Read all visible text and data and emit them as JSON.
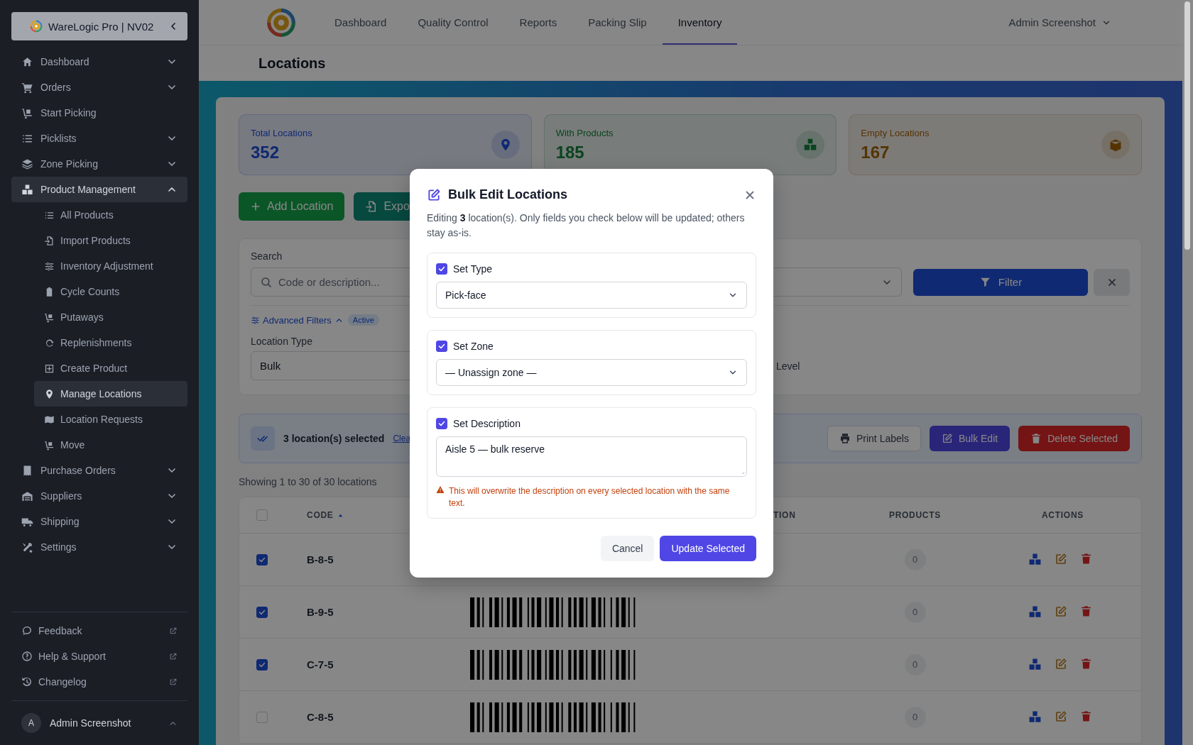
{
  "sidebar": {
    "brand": "WareLogic Pro | NV02",
    "items": [
      {
        "label": "Dashboard",
        "selected": false,
        "expanded": false
      },
      {
        "label": "Orders",
        "selected": false,
        "expanded": false
      },
      {
        "label": "Start Picking",
        "selected": false
      },
      {
        "label": "Picklists",
        "selected": false,
        "expanded": false
      },
      {
        "label": "Zone Picking",
        "selected": false,
        "expanded": false
      },
      {
        "label": "Product Management",
        "selected": false,
        "expanded": true,
        "children": [
          {
            "label": "All Products",
            "selected": false
          },
          {
            "label": "Import Products",
            "selected": false
          },
          {
            "label": "Inventory Adjustment",
            "selected": false
          },
          {
            "label": "Cycle Counts",
            "selected": false
          },
          {
            "label": "Putaways",
            "selected": false
          },
          {
            "label": "Replenishments",
            "selected": false
          },
          {
            "label": "Create Product",
            "selected": false
          },
          {
            "label": "Manage Locations",
            "selected": true
          },
          {
            "label": "Location Requests",
            "selected": false
          },
          {
            "label": "Move",
            "selected": false
          }
        ]
      },
      {
        "label": "Purchase Orders",
        "selected": false,
        "expanded": false
      },
      {
        "label": "Suppliers",
        "selected": false,
        "expanded": false
      },
      {
        "label": "Shipping",
        "selected": false,
        "expanded": false
      },
      {
        "label": "Settings",
        "selected": false,
        "expanded": false
      }
    ],
    "footer_links": [
      "Feedback",
      "Help & Support",
      "Changelog"
    ],
    "user": {
      "initial": "A",
      "name": "Admin Screenshot"
    }
  },
  "top_nav": {
    "items": [
      {
        "label": "Dashboard",
        "selected": false
      },
      {
        "label": "Quality Control",
        "selected": false
      },
      {
        "label": "Reports",
        "selected": false
      },
      {
        "label": "Packing Slip",
        "selected": false
      },
      {
        "label": "Inventory",
        "selected": true
      }
    ],
    "user_menu": "Admin Screenshot"
  },
  "page_title": "Locations",
  "stats": [
    {
      "label": "Total Locations",
      "value": "352",
      "kind": "blue"
    },
    {
      "label": "With Products",
      "value": "185",
      "kind": "green"
    },
    {
      "label": "Empty Locations",
      "value": "167",
      "kind": "amber"
    }
  ],
  "actions": [
    {
      "label": "Add Location",
      "kind": "add"
    },
    {
      "label": "Expo",
      "kind": "export"
    }
  ],
  "filters": {
    "search_label": "Search",
    "search_placeholder": "Code or description...",
    "filter_button": "Filter",
    "advanced_filters": "Advanced Filters",
    "advanced_expanded": true,
    "active_badge": "Active",
    "location_type_label": "Location Type",
    "location_type_value": "Bulk",
    "level_label": "Level"
  },
  "selection": {
    "count_text": "3 location(s) selected",
    "clear_link": "Clea",
    "buttons": [
      {
        "label": "Print Labels",
        "kind": "outline"
      },
      {
        "label": "Bulk Edit",
        "kind": "primary"
      },
      {
        "label": "Delete Selected",
        "kind": "danger"
      }
    ]
  },
  "showing": "Showing 1 to 30 of 30 locations",
  "table": {
    "all_checked": false,
    "columns": [
      {
        "label": "CODE",
        "sort_ascending": true
      },
      {
        "label": "TION"
      },
      {
        "label": "PRODUCTS"
      },
      {
        "label": "ACTIONS"
      }
    ],
    "rows": [
      {
        "checked": true,
        "code": "B-8-5",
        "products": "0"
      },
      {
        "checked": true,
        "code": "B-9-5",
        "products": "0"
      },
      {
        "checked": true,
        "code": "C-7-5",
        "products": "0"
      },
      {
        "checked": false,
        "code": "C-8-5",
        "products": "0"
      }
    ]
  },
  "modal": {
    "title": "Bulk Edit Locations",
    "intro": "Editing **3** location(s). Only fields you check below will be updated; others stay as-is.",
    "sections": [
      {
        "kind": "select",
        "label": "Set Type",
        "checked": true,
        "value": "Pick-face"
      },
      {
        "kind": "select",
        "label": "Set Zone",
        "checked": true,
        "value": "— Unassign zone —"
      },
      {
        "kind": "textarea",
        "label": "Set Description",
        "checked": true,
        "value": "Aisle 5 — bulk reserve",
        "warning": "This will overwrite the description on every selected location with the same text."
      }
    ],
    "buttons": [
      {
        "label": "Cancel",
        "kind": "secondary"
      },
      {
        "label": "Update Selected",
        "kind": "primary"
      }
    ]
  }
}
